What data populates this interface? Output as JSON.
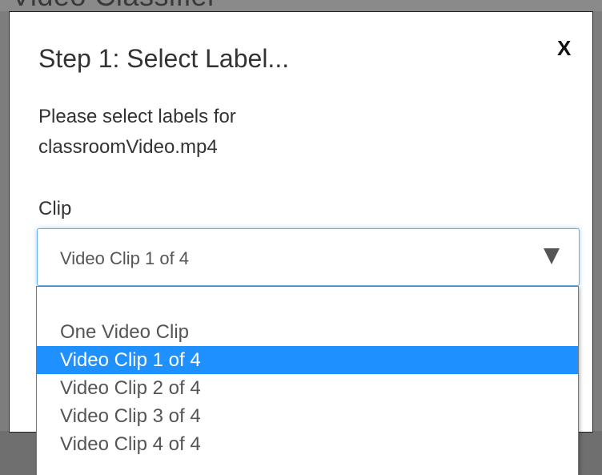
{
  "backdrop": {
    "partial_heading": "Video Classifier"
  },
  "dialog": {
    "title": "Step 1: Select Label...",
    "close_label": "X",
    "description": "Please select labels for classroomVideo.mp4",
    "field_label": "Clip",
    "select": {
      "value": "Video Clip 1 of 4",
      "caret_icon": "caret-down-icon",
      "focus_color": "#66afe9"
    },
    "dropdown": {
      "options": [
        "One Video Clip",
        "Video Clip 1 of 4",
        "Video Clip 2 of 4",
        "Video Clip 3 of 4",
        "Video Clip 4 of 4"
      ],
      "highlighted": "Video Clip 1 of 4",
      "highlight_color": "#1e90ff"
    }
  }
}
